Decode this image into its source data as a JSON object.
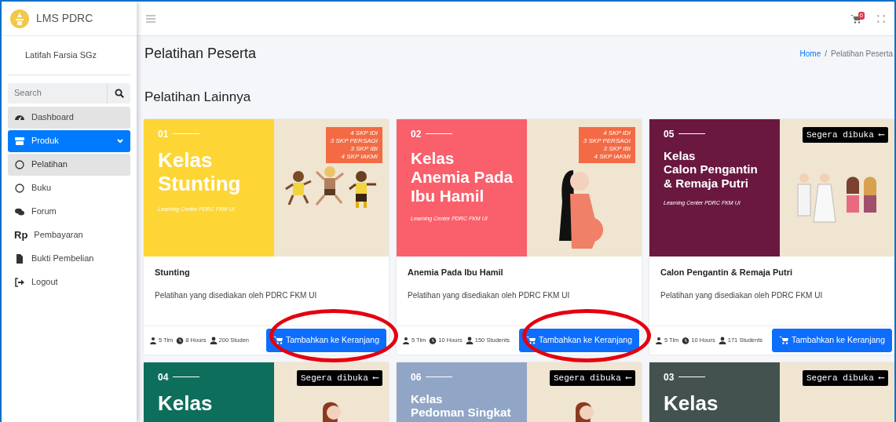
{
  "brand": {
    "name": "LMS PDRC"
  },
  "user": {
    "name": "Latifah Farsia SGz"
  },
  "search": {
    "placeholder": "Search"
  },
  "sidebar": {
    "items": [
      {
        "label": "Dashboard",
        "selected": false,
        "hovered": true
      },
      {
        "label": "Produk",
        "selected": true,
        "hovered": false,
        "expanded": true,
        "children": [
          {
            "label": "Pelatihan",
            "selected": true
          },
          {
            "label": "Buku",
            "selected": false
          }
        ]
      },
      {
        "label": "Forum",
        "selected": false,
        "hovered": false
      },
      {
        "label": "Pembayaran",
        "icon_text": "Rp",
        "selected": false,
        "hovered": false
      },
      {
        "label": "Bukti Pembelian",
        "selected": false,
        "hovered": false
      },
      {
        "label": "Logout",
        "selected": false,
        "hovered": false
      }
    ]
  },
  "topbar": {
    "cart_count": "0"
  },
  "page": {
    "title": "Pelatihan Peserta",
    "breadcrumb_separator": "/",
    "breadcrumb": [
      {
        "label": "Home",
        "link": true
      },
      {
        "label": "Pelatihan Peserta",
        "link": false
      }
    ]
  },
  "section": {
    "title": "Pelatihan Lainnya"
  },
  "courses": [
    {
      "number": "01",
      "banner_lines": [
        "Kelas",
        "Stunting"
      ],
      "subtitle": "Learning Center PDRC FKM UI",
      "color": "#fdd535",
      "tag": {
        "kind": "skp",
        "lines": [
          "4 SKP IDI",
          "3 SKP PERSAGI",
          "3 SKP IBI",
          "4 SKP IAKMI"
        ]
      },
      "title": "Stunting",
      "description": "Pelatihan yang disediakan oleh PDRC FKM UI",
      "stats": [
        "5 Tim",
        "8 Hours",
        "200 Studen"
      ],
      "button": "Tambahkan ke Keranjang",
      "circled": true
    },
    {
      "number": "02",
      "banner_lines": [
        "Kelas",
        "Anemia Pada",
        "Ibu Hamil"
      ],
      "subtitle": "Learning Center PDRC FKM UI",
      "color": "#fa5f6c",
      "tag": {
        "kind": "skp",
        "lines": [
          "4 SKP IDI",
          "3 SKP PERSAGI",
          "3 SKP IBI",
          "4 SKP IAKMI"
        ]
      },
      "title": "Anemia Pada Ibu Hamil",
      "description": "Pelatihan yang disediakan oleh PDRC FKM UI",
      "stats": [
        "5 Tim",
        "10 Hours",
        "150 Students"
      ],
      "button": "Tambahkan ke Keranjang",
      "circled": true
    },
    {
      "number": "05",
      "banner_lines": [
        "Kelas",
        "Calon Pengantin",
        "& Remaja Putri"
      ],
      "subtitle": "Learning Center PDRC FKM UI",
      "color": "#6a1840",
      "tag": {
        "kind": "soon",
        "text": "Segera dibuka ⟵"
      },
      "title": "Calon Pengantin & Remaja Putri",
      "description": "Pelatihan yang disediakan oleh PDRC FKM UI",
      "stats": [
        "5 Tim",
        "10 Hours",
        "171 Students"
      ],
      "button": "Tambahkan ke Keranjang",
      "circled": false
    },
    {
      "number": "04",
      "banner_lines": [
        "Kelas"
      ],
      "color": "#0d6e5c",
      "tag": {
        "kind": "soon",
        "text": "Segera dibuka ⟵"
      }
    },
    {
      "number": "06",
      "banner_lines": [
        "Kelas",
        "Pedoman Singkat"
      ],
      "color": "#91a6c6",
      "tag": {
        "kind": "soon",
        "text": "Segera dibuka ⟵"
      }
    },
    {
      "number": "03",
      "banner_lines": [
        "Kelas"
      ],
      "color": "#43524f",
      "tag": {
        "kind": "soon",
        "text": "Segera dibuka ⟵"
      }
    }
  ]
}
